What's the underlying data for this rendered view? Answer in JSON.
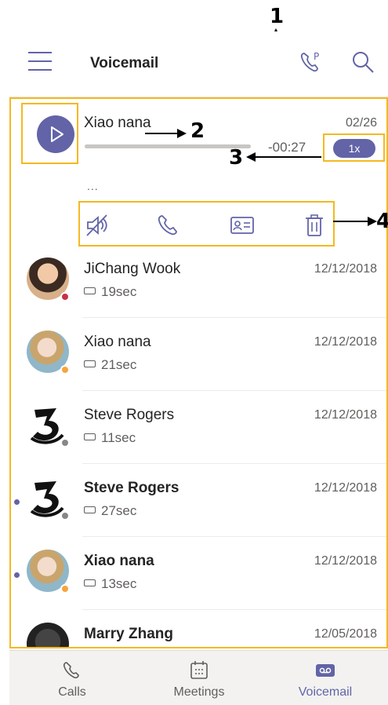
{
  "header": {
    "title": "Voicemail"
  },
  "annotations": {
    "one": "1",
    "two": "2",
    "three": "3",
    "four": "4"
  },
  "expanded": {
    "name": "Xiao nana",
    "date": "02/26",
    "time": "-00:27",
    "speed": "1x",
    "progress_fraction": 1.0,
    "more": "..."
  },
  "rows": [
    {
      "name": "JiChang Wook",
      "duration": "19sec",
      "date": "12/12/2018",
      "presence": "busy",
      "unread": false
    },
    {
      "name": "Xiao nana",
      "duration": "21sec",
      "date": "12/12/2018",
      "presence": "away",
      "unread": false
    },
    {
      "name": "Steve Rogers",
      "duration": "11sec",
      "date": "12/12/2018",
      "presence": "offline",
      "unread": false
    },
    {
      "name": "Steve Rogers",
      "duration": "27sec",
      "date": "12/12/2018",
      "presence": "offline",
      "unread": true
    },
    {
      "name": "Xiao nana",
      "duration": "13sec",
      "date": "12/12/2018",
      "presence": "away",
      "unread": true
    },
    {
      "name": "Marry Zhang",
      "duration": "",
      "date": "12/05/2018",
      "presence": "offline",
      "unread": false
    }
  ],
  "nav": {
    "calls": "Calls",
    "meetings": "Meetings",
    "voicemail": "Voicemail"
  },
  "colors": {
    "accent": "#6264a7",
    "highlight": "#f5b820",
    "busy": "#c4314b",
    "away": "#f8a33c",
    "offline": "#8a8886"
  }
}
